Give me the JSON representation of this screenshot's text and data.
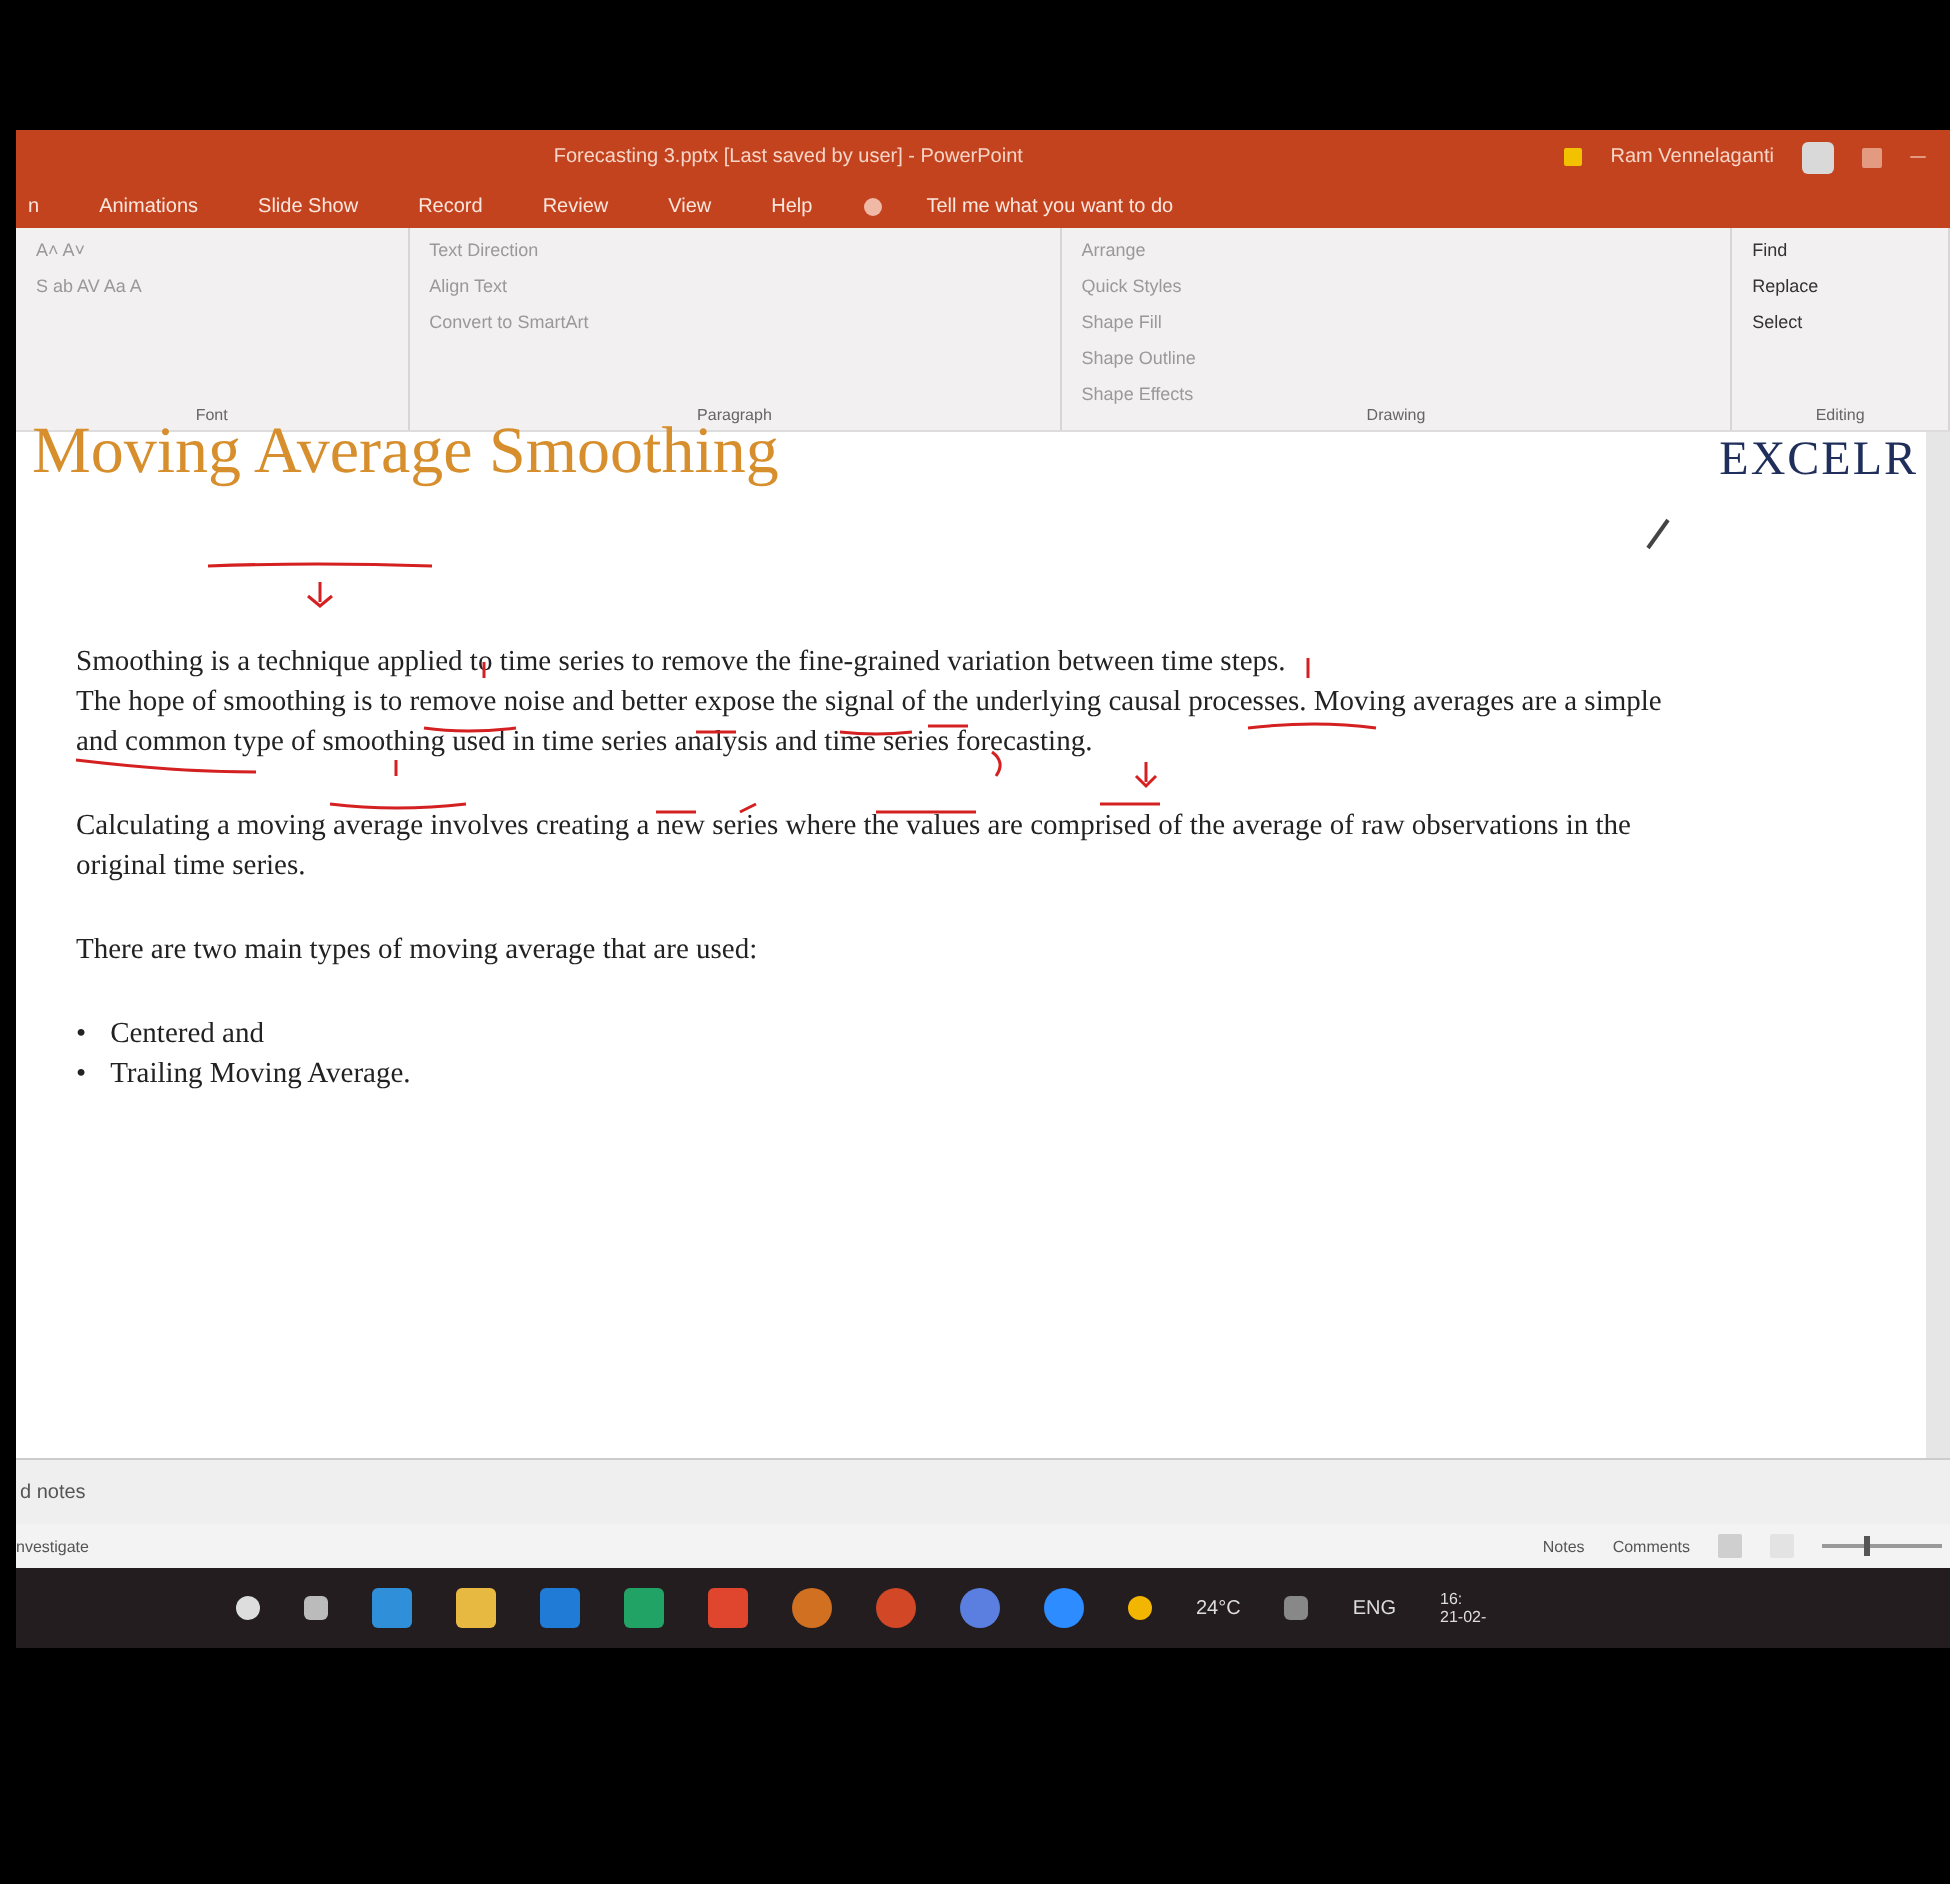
{
  "window": {
    "title": "Forecasting 3.pptx [Last saved by user]  -  PowerPoint",
    "user": "Ram Vennelaganti"
  },
  "tabs": [
    {
      "label": "n",
      "selected": false
    },
    {
      "label": "Animations",
      "selected": false
    },
    {
      "label": "Slide Show",
      "selected": false
    },
    {
      "label": "Record",
      "selected": false
    },
    {
      "label": "Review",
      "selected": false
    },
    {
      "label": "View",
      "selected": false
    },
    {
      "label": "Help",
      "selected": false
    }
  ],
  "tell_me": "Tell me what you want to do",
  "ribbon": {
    "groups": [
      {
        "label": "Font",
        "items": [
          "A˄ A˅",
          "S  ab  AV  Aa  A"
        ]
      },
      {
        "label": "Paragraph",
        "items": [
          "Text Direction",
          "Align Text",
          "Convert to SmartArt"
        ]
      },
      {
        "label": "Drawing",
        "items": [
          "Arrange",
          "Quick Styles",
          "Shape Fill",
          "Shape Outline",
          "Shape Effects"
        ]
      },
      {
        "label": "Editing",
        "items": [
          "Find",
          "Replace",
          "Select"
        ]
      }
    ]
  },
  "slide": {
    "title": "Moving Average Smoothing",
    "logo": "EXCELR",
    "paragraphs": [
      "Smoothing is a technique applied to time series to remove the fine-grained variation between time steps.",
      "The hope of smoothing is to remove noise and better expose the signal of the underlying causal processes. Moving averages are a simple and common type of smoothing used in time series analysis and time series forecasting.",
      "Calculating a moving average involves creating a new series where the values are comprised of the average of raw observations in the original time series.",
      "There are two main types of moving average that are used:"
    ],
    "bullets": [
      {
        "marker": "•",
        "text": "Centered and"
      },
      {
        "marker": "•",
        "text": "Trailing Moving Average."
      }
    ]
  },
  "notes": "d notes",
  "status_bar": {
    "left": "nvestigate",
    "notes": "Notes",
    "comments": "Comments",
    "zoom": {
      "level": 0.35
    }
  },
  "taskbar": {
    "weather": "24°C",
    "language": "ENG",
    "time": "16:",
    "date": "21-02-"
  }
}
